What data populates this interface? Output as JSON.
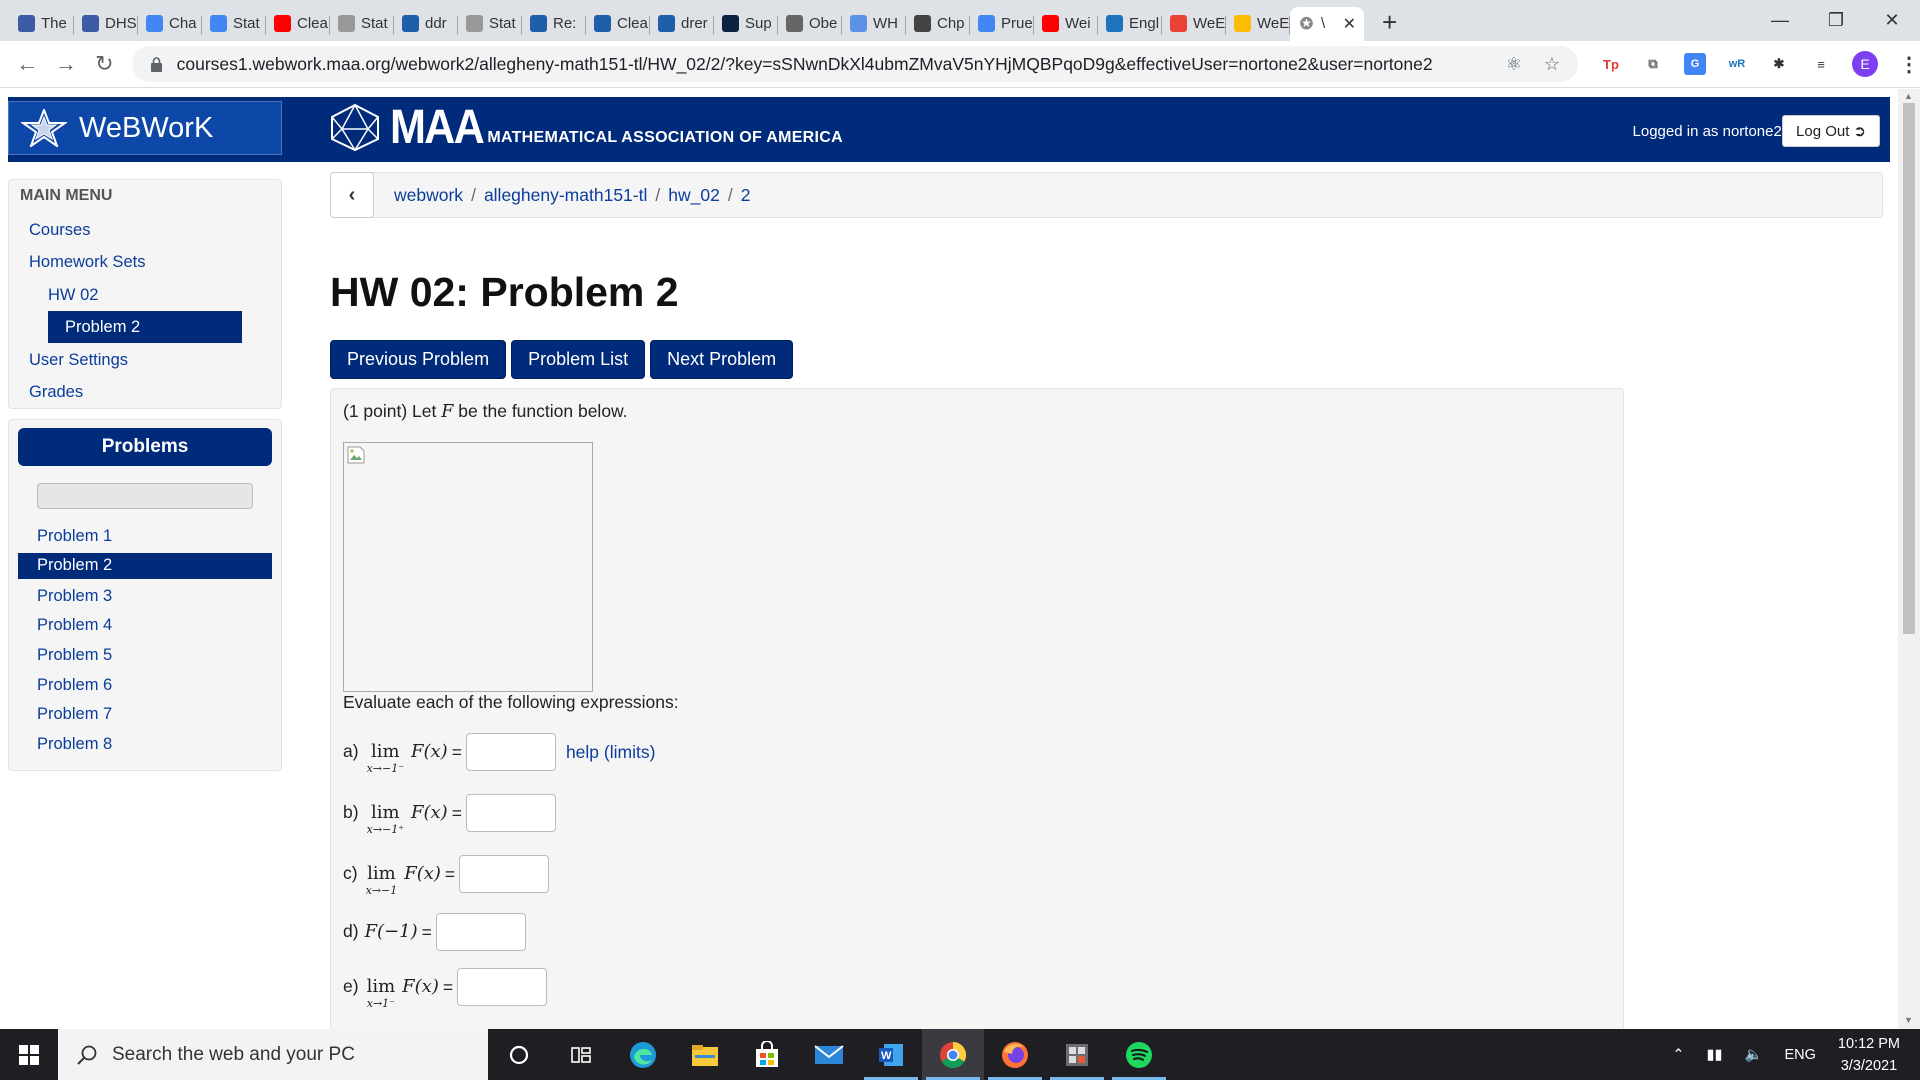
{
  "browser": {
    "tabs": [
      {
        "icon": "dhs-icon",
        "title": "The",
        "color": "#3b5ba5"
      },
      {
        "icon": "dhs-icon",
        "title": "DHS",
        "color": "#3b5ba5"
      },
      {
        "icon": "docs-icon",
        "title": "Cha",
        "color": "#4285f4"
      },
      {
        "icon": "docs-icon",
        "title": "Stat",
        "color": "#4285f4"
      },
      {
        "icon": "youtube-icon",
        "title": "Clea",
        "color": "#ff0000"
      },
      {
        "icon": "grid-icon",
        "title": "Stat",
        "color": "#999999"
      },
      {
        "icon": "sheet-icon",
        "title": "ddr",
        "color": "#1f5faa"
      },
      {
        "icon": "grid-icon",
        "title": "Stat",
        "color": "#999999"
      },
      {
        "icon": "sheet-icon",
        "title": "Re:",
        "color": "#1f5faa"
      },
      {
        "icon": "book-icon",
        "title": "Clea",
        "color": "#1f5faa"
      },
      {
        "icon": "sheet-icon",
        "title": "drer",
        "color": "#1f5faa"
      },
      {
        "icon": "nd-icon",
        "title": "Sup",
        "color": "#0c2340"
      },
      {
        "icon": "r-icon",
        "title": "Obe",
        "color": "#666666"
      },
      {
        "icon": "globe-icon",
        "title": "WH",
        "color": "#5b92e5"
      },
      {
        "icon": "chp-icon",
        "title": "Chp",
        "color": "#444444"
      },
      {
        "icon": "docs-icon",
        "title": "Prue",
        "color": "#4285f4"
      },
      {
        "icon": "youtube-icon",
        "title": "Wei",
        "color": "#ff0000"
      },
      {
        "icon": "wr-icon",
        "title": "Engl",
        "color": "#1c75bc"
      },
      {
        "icon": "gmail-icon",
        "title": "WeE",
        "color": "#ea4335"
      },
      {
        "icon": "triangle-icon",
        "title": "WeE",
        "color": "#fbbc04"
      }
    ],
    "active_tab": {
      "icon": "webwork-star-icon",
      "title": "\\"
    },
    "url": "courses1.webwork.maa.org/webwork2/allegheny-math151-tl/HW_02/2/?key=sSNwnDkXl4ubmZMvaV5nYHjMQBPqoD9g&effectiveUser=nortone2&user=nortone2",
    "profile_initial": "E",
    "ext_icons": [
      "tp-icon",
      "copy-icon",
      "google-translate-icon",
      "wr-icon",
      "puzzle-icon",
      "media-icon"
    ]
  },
  "header": {
    "app_name": "WeBWorK",
    "maa_big": "MAA",
    "maa_full": "MATHEMATICAL ASSOCIATION OF AMERICA",
    "logged_in": "Logged in as nortone2.",
    "logout_label": "Log Out"
  },
  "main_menu": {
    "title": "MAIN MENU",
    "items": [
      "Courses",
      "Homework Sets",
      "HW 02",
      "Problem 2",
      "User Settings",
      "Grades"
    ]
  },
  "problems_panel": {
    "title": "Problems",
    "items": [
      "Problem 1",
      "Problem 2",
      "Problem 3",
      "Problem 4",
      "Problem 5",
      "Problem 6",
      "Problem 7",
      "Problem 8"
    ],
    "active": "Problem 2"
  },
  "breadcrumb": {
    "items": [
      "webwork",
      "allegheny-math151-tl",
      "hw_02",
      "2"
    ],
    "separator": "/"
  },
  "problem": {
    "title": "HW 02: Problem 2",
    "buttons": {
      "prev": "Previous Problem",
      "list": "Problem List",
      "next": "Next Problem"
    },
    "intro_pre": "(1 point) Let",
    "intro_var": "F",
    "intro_post": "be the function below.",
    "evaluate": "Evaluate each of the following expressions:",
    "help_limits": "help (limits)",
    "questions": [
      {
        "label": "a)",
        "lim": "lim",
        "sub": "x→−1⁻",
        "expr": "F(x)",
        "eq": "="
      },
      {
        "label": "b)",
        "lim": "lim",
        "sub": "x→−1⁺",
        "expr": "F(x)",
        "eq": "="
      },
      {
        "label": "c)",
        "lim": "lim",
        "sub": "x→−1",
        "expr": "F(x)",
        "eq": "="
      },
      {
        "label": "d)",
        "expr": "F(−1)",
        "eq": "="
      },
      {
        "label": "e)",
        "lim": "lim",
        "sub": "x→1⁻",
        "expr": "F(x)",
        "eq": "="
      }
    ]
  },
  "taskbar": {
    "search_placeholder": "Search the web and your PC",
    "apps": [
      "cortana-icon",
      "task-view-icon",
      "edge-icon",
      "file-explorer-icon",
      "store-icon",
      "mail-icon",
      "word-icon",
      "chrome-icon",
      "firefox-icon",
      "calculator-icon",
      "spotify-icon"
    ],
    "language": "ENG",
    "time": "10:12 PM",
    "date": "3/3/2021"
  }
}
